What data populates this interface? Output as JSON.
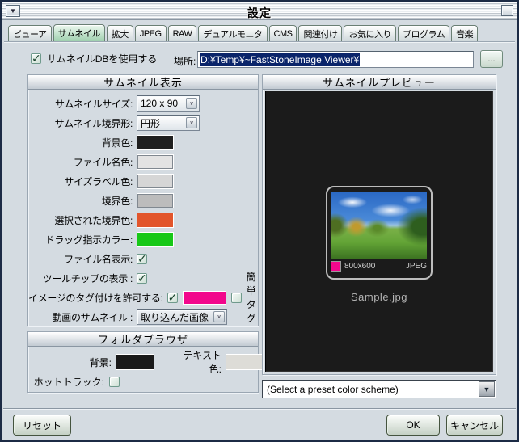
{
  "window": {
    "title": "設定"
  },
  "icons": {
    "window_menu_arrow": "▼",
    "combo_arrow": "∨",
    "scheme_arrow": "▼"
  },
  "tabs": {
    "items": [
      "ビューア",
      "サムネイル",
      "拡大",
      "JPEG",
      "RAW",
      "デュアルモニタ",
      "CMS",
      "関連付け",
      "お気に入り",
      "プログラム",
      "音楽"
    ],
    "selected": "サムネイル"
  },
  "db": {
    "use_db_label": "サムネイルDBを使用する",
    "use_db_checked": true,
    "location_label": "場所:",
    "location_value": "D:¥Temp¥~FastStoneImage Viewer¥",
    "browse_label": "..."
  },
  "thumb_display": {
    "title": "サムネイル表示",
    "size_label": "サムネイルサイズ:",
    "size_value": "120 x 90",
    "border_shape_label": "サムネイル境界形:",
    "border_shape_value": "円形",
    "bg_color_label": "背景色:",
    "file_name_color_label": "ファイル名色:",
    "size_label_color_label": "サイズラベル色:",
    "border_color_label": "境界色:",
    "selected_border_color_label": "選択された境界色:",
    "drag_color_label": "ドラッグ指示カラー:",
    "show_filename_label": "ファイル名表示:",
    "show_filename_checked": true,
    "show_tooltip_label": "ツールチップの表示 :",
    "show_tooltip_checked": true,
    "allow_tag_label": "イメージのタグ付けを許可する:",
    "allow_tag_checked": true,
    "simple_tag_label": "簡単タグ",
    "simple_tag_checked": false,
    "video_thumb_label": "動画のサムネイル :",
    "video_thumb_value": "取り込んだ画像",
    "colors": {
      "background": "#1f1f1f",
      "file_name": "#e3e3e3",
      "size_label": "#d6d6d6",
      "border": "#bcbcbc",
      "selected_border": "#e2552b",
      "drag": "#17c817",
      "tag": "#f2078c"
    }
  },
  "folder_browser": {
    "title": "フォルダブラウザ",
    "bg_label": "背景:",
    "text_color_label": "テキスト色:",
    "hot_track_label": "ホットトラック:",
    "hot_track_checked": false,
    "colors": {
      "background": "#1a1a1a",
      "text": "#dddcd7"
    }
  },
  "preview": {
    "title": "サムネイルプレビュー",
    "file_name": "Sample.jpg",
    "dimensions": "800x600",
    "format": "JPEG",
    "scheme_select": "(Select a preset color scheme)"
  },
  "buttons": {
    "reset": "リセット",
    "ok": "OK",
    "cancel": "キャンセル"
  }
}
